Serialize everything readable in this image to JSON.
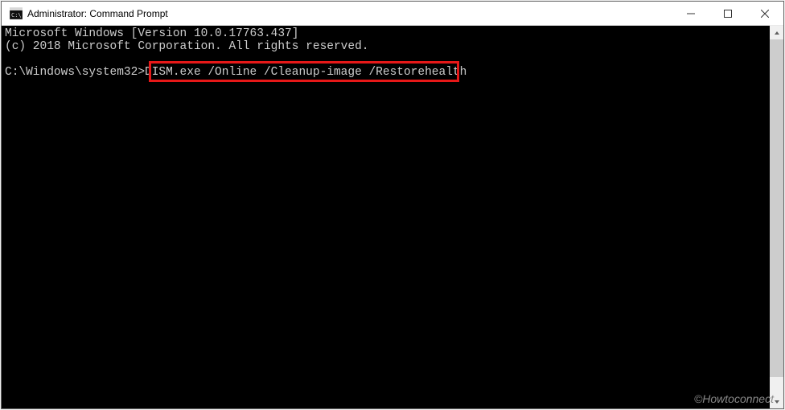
{
  "window": {
    "title": "Administrator: Command Prompt"
  },
  "console": {
    "line1": "Microsoft Windows [Version 10.0.17763.437]",
    "line2": "(c) 2018 Microsoft Corporation. All rights reserved.",
    "prompt": "C:\\Windows\\system32>",
    "command": "DISM.exe /Online /Cleanup-image /Restorehealth"
  },
  "watermark": "©Howtoconnect",
  "colors": {
    "highlight": "#e61818",
    "console_bg": "#000000",
    "console_fg": "#cccccc"
  }
}
